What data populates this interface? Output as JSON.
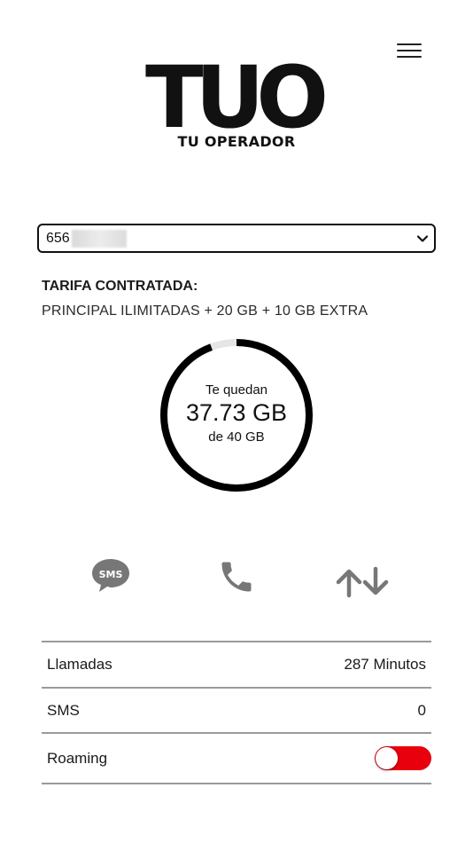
{
  "header": {
    "logo_main": "TUO",
    "logo_sub": "TU OPERADOR"
  },
  "line_selector": {
    "visible_number": "656",
    "masked": true
  },
  "tariff": {
    "title": "TARIFA CONTRATADA:",
    "name": "PRINCIPAL ILIMITADAS + 20 GB + 10 GB EXTRA"
  },
  "data_usage": {
    "label_top": "Te quedan",
    "remaining": "37.73 GB",
    "label_bottom": "de 40 GB",
    "remaining_value": 37.73,
    "total_value": 40
  },
  "icons": {
    "sms": "sms-bubble-icon",
    "call": "phone-icon",
    "data": "data-transfer-icon"
  },
  "consumption": {
    "rows": [
      {
        "label": "Llamadas",
        "value": "287 Minutos"
      },
      {
        "label": "SMS",
        "value": "0"
      },
      {
        "label": "Roaming",
        "value": ""
      }
    ],
    "roaming_enabled": true
  },
  "colors": {
    "toggle_on": "#e8000d",
    "icon_gray": "#777777",
    "ring": "#000000",
    "ring_track": "#e5e5e5"
  }
}
